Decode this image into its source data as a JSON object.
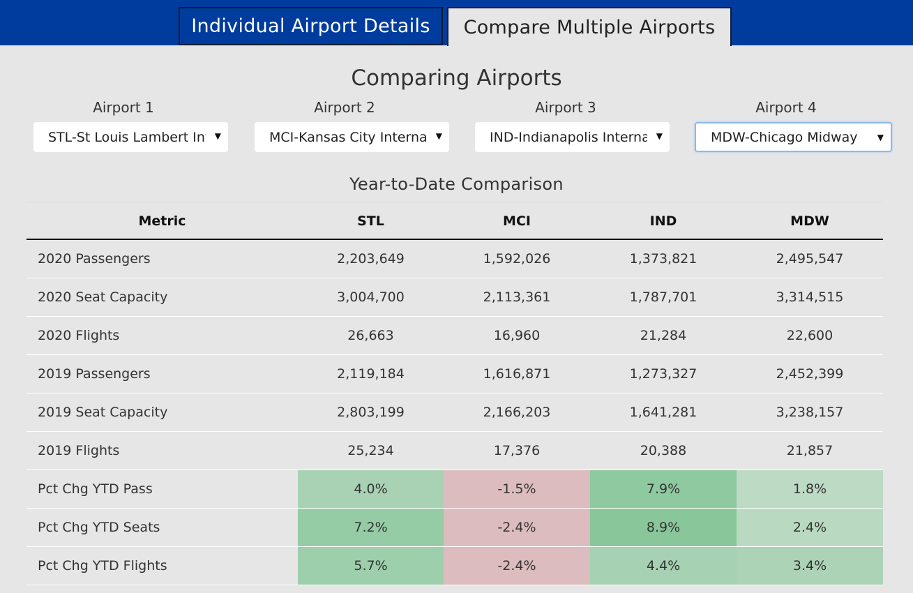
{
  "tabs": [
    {
      "label": "Individual Airport Details"
    },
    {
      "label": "Compare Multiple Airports"
    }
  ],
  "page_title": "Comparing Airports",
  "airports": [
    {
      "label": "Airport 1",
      "value": "STL-St Louis Lambert Int"
    },
    {
      "label": "Airport 2",
      "value": "MCI-Kansas City Interna"
    },
    {
      "label": "Airport 3",
      "value": "IND-Indianapolis Interna"
    },
    {
      "label": "Airport 4",
      "value": "MDW-Chicago Midway"
    }
  ],
  "caret": "▼",
  "section_title": "Year-to-Date Comparison",
  "table": {
    "headers": [
      "Metric",
      "STL",
      "MCI",
      "IND",
      "MDW"
    ],
    "rows": [
      {
        "cells": [
          "2020 Passengers",
          "2,203,649",
          "1,592,026",
          "1,373,821",
          "2,495,547"
        ]
      },
      {
        "cells": [
          "2020 Seat Capacity",
          "3,004,700",
          "2,113,361",
          "1,787,701",
          "3,314,515"
        ]
      },
      {
        "cells": [
          "2020 Flights",
          "26,663",
          "16,960",
          "21,284",
          "22,600"
        ]
      },
      {
        "cells": [
          "2019 Passengers",
          "2,119,184",
          "1,616,871",
          "1,273,327",
          "2,452,399"
        ]
      },
      {
        "cells": [
          "2019 Seat Capacity",
          "2,803,199",
          "2,166,203",
          "1,641,281",
          "3,238,157"
        ]
      },
      {
        "cells": [
          "2019 Flights",
          "25,234",
          "17,376",
          "20,388",
          "21,857"
        ]
      },
      {
        "cells": [
          "Pct Chg YTD Pass",
          "4.0%",
          "-1.5%",
          "7.9%",
          "1.8%"
        ],
        "colors": [
          "#a9d2b4",
          "#dcbcbe",
          "#8ec9a0",
          "#bcdac4"
        ]
      },
      {
        "cells": [
          "Pct Chg YTD Seats",
          "7.2%",
          "-2.4%",
          "8.9%",
          "2.4%"
        ],
        "colors": [
          "#95cca6",
          "#dcbcbe",
          "#89c79b",
          "#b9d9c1"
        ]
      },
      {
        "cells": [
          "Pct Chg YTD Flights",
          "5.7%",
          "-2.4%",
          "4.4%",
          "3.4%"
        ],
        "colors": [
          "#9ecfad",
          "#dcbcbe",
          "#a6d1b2",
          "#acd3b6"
        ]
      }
    ]
  },
  "colors": {
    "header_bg": "#003c9e",
    "page_bg": "#e6e6e6"
  }
}
